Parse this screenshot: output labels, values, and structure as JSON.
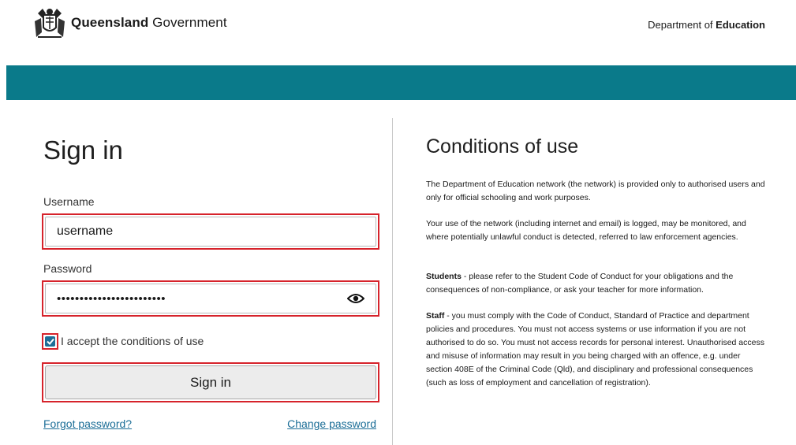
{
  "header": {
    "brand_bold": "Queensland",
    "brand_rest": " Government",
    "dept_prefix": "Department of ",
    "dept_bold": "Education",
    "bar_color": "#0a7a8a"
  },
  "signin": {
    "title": "Sign in",
    "username_label": "Username",
    "username_value": "username",
    "password_label": "Password",
    "password_value": "••••••••••••••••••••••••",
    "show_password_icon": "eye-icon",
    "accept_checked": true,
    "accept_label": "I accept the conditions of use",
    "submit_label": "Sign in",
    "forgot_link": "Forgot password?",
    "change_link": "Change password",
    "highlight_color": "#d6232b",
    "link_color": "#1c6e97"
  },
  "conditions": {
    "title": "Conditions of use",
    "p1": "The Department of Education network (the network) is provided only to authorised users and only for official schooling and work purposes.",
    "p2": "Your use of the network (including internet and email) is logged, may be monitored, and where potentially unlawful conduct is detected, referred to law enforcement agencies.",
    "p3_bold": "Students",
    "p3": " - please refer to the Student Code of Conduct for your obligations and the consequences of non-compliance, or ask your teacher for more information.",
    "p4_bold": "Staff",
    "p4": " - you must comply with the Code of Conduct, Standard of Practice and department policies and procedures. You must not access systems or use information if you are not authorised to do so. You must not access records for personal interest. Unauthorised access and misuse of information may result in you being charged with an offence, e.g. under section 408E of the Criminal Code (Qld), and disciplinary and professional consequences (such as loss of employment and cancellation of registration)."
  }
}
